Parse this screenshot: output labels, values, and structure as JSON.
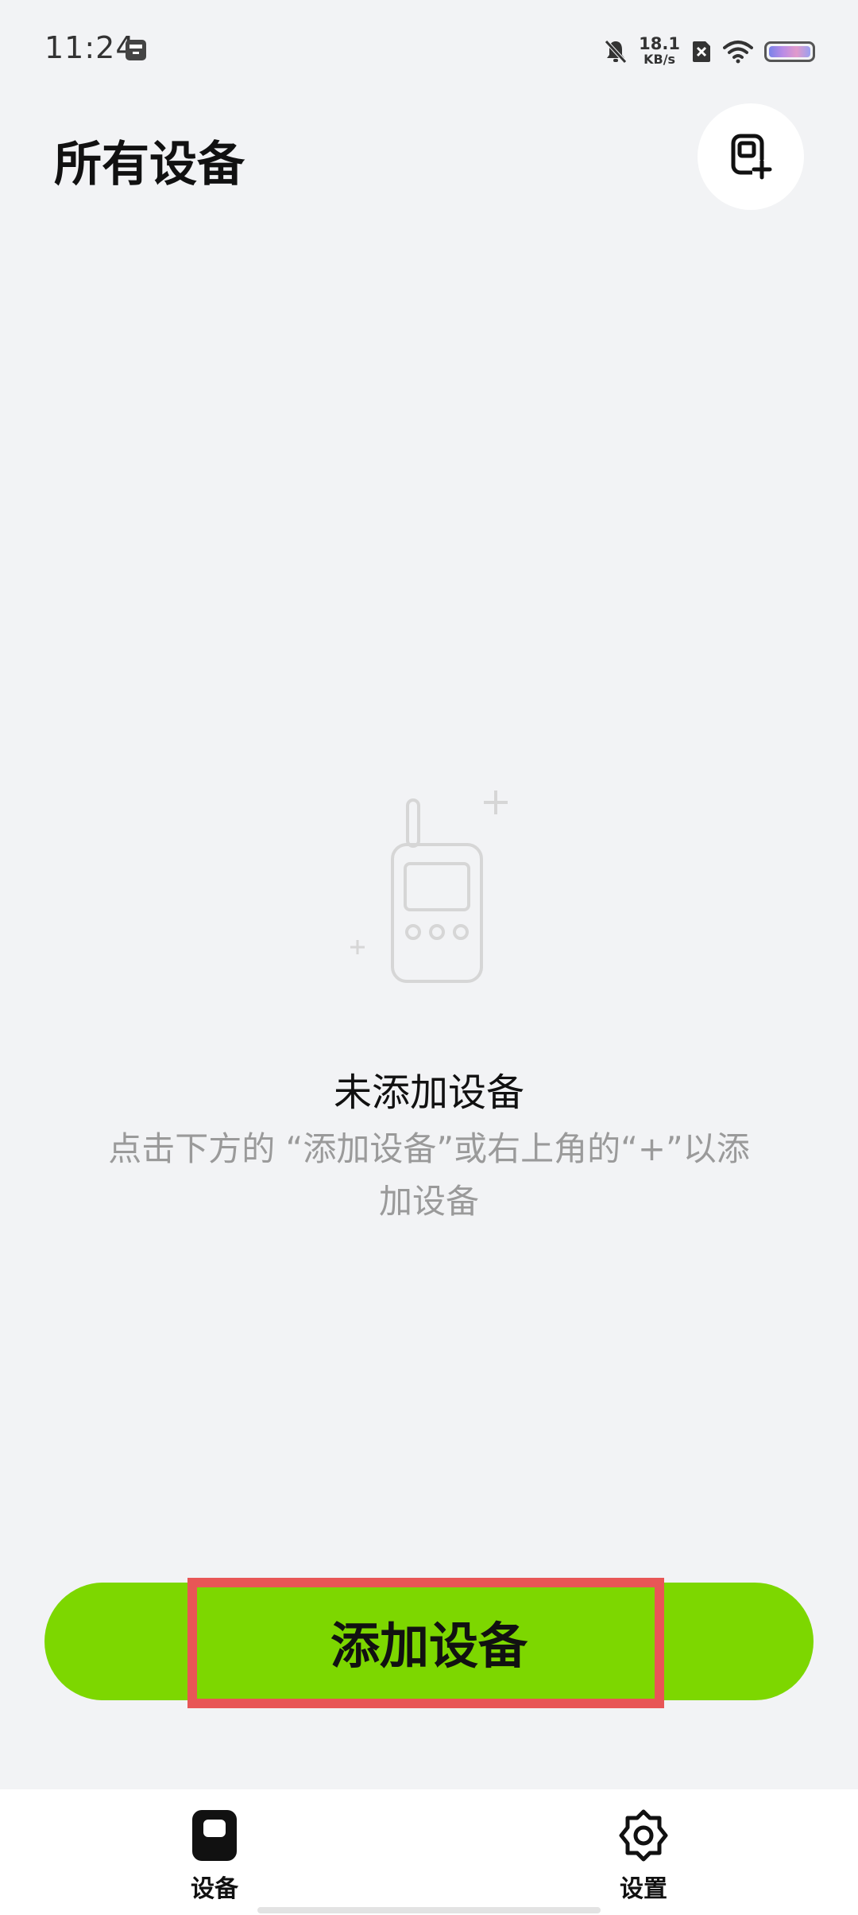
{
  "status_bar": {
    "time": "11:24",
    "net_speed_value": "18.1",
    "net_speed_unit": "KB/s"
  },
  "header": {
    "title": "所有设备"
  },
  "empty_state": {
    "title": "未添加设备",
    "hint": "点击下方的 “添加设备”或右上角的“+”以添加设备"
  },
  "primary_button": {
    "label": "添加设备"
  },
  "tabs": [
    {
      "label": "设备",
      "icon": "device-icon",
      "active": true
    },
    {
      "label": "设置",
      "icon": "gear-icon",
      "active": false
    }
  ],
  "colors": {
    "accent": "#7dd700",
    "background": "#f2f3f5",
    "highlight": "#e85656"
  }
}
